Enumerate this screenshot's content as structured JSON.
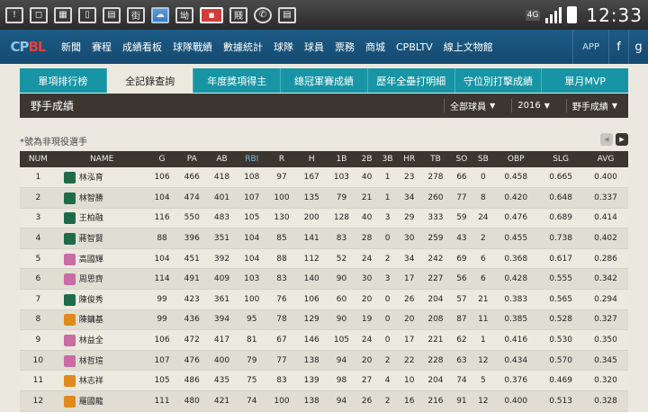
{
  "statusbar": {
    "network": "4G",
    "time": "12:33",
    "icons": [
      "m-icon",
      "phone-app-icon",
      "store-icon",
      "mobile-icon",
      "chat-icon",
      "street-icon",
      "weather-icon",
      "pos-icon",
      "costco-icon",
      "line-icon",
      "call-icon",
      "message-icon"
    ],
    "glyphs": [
      "!",
      "◻",
      "▦",
      "▯",
      "▤",
      "街",
      "☁",
      "坳",
      "■",
      "賤",
      "✆",
      "▤"
    ]
  },
  "logo": {
    "part1": "CP",
    "part2": "BL"
  },
  "nav": {
    "items": [
      "新聞",
      "賽程",
      "成績看板",
      "球隊戰績",
      "數據統計",
      "球隊",
      "球員",
      "票務",
      "商城",
      "CPBLTV",
      "線上文物館"
    ],
    "app": "APP",
    "facebook": "f",
    "google": "g"
  },
  "tabs": [
    "單項排行榜",
    "全記錄查詢",
    "年度獎項得主",
    "總冠軍賽成績",
    "歷年全壘打明細",
    "守位別打擊成績",
    "單月MVP"
  ],
  "active_tab": 1,
  "titlebar": {
    "title": "野手成績",
    "filters": [
      "全部球員",
      "2016",
      "野手成績"
    ]
  },
  "note": "*號為非現役選手",
  "pager": {
    "prev": "◀",
    "next": "▶"
  },
  "table": {
    "headers": [
      "NUM",
      "NAME",
      "G",
      "PA",
      "AB",
      "RBI",
      "R",
      "H",
      "1B",
      "2B",
      "3B",
      "HR",
      "TB",
      "SO",
      "SB",
      "OBP",
      "SLG",
      "AVG"
    ],
    "rows": [
      {
        "team": "green",
        "cells": [
          "1",
          "林泓育",
          "106",
          "466",
          "418",
          "108",
          "97",
          "167",
          "103",
          "40",
          "1",
          "23",
          "278",
          "66",
          "0",
          "0.458",
          "0.665",
          "0.400"
        ]
      },
      {
        "team": "green",
        "cells": [
          "2",
          "林智勝",
          "104",
          "474",
          "401",
          "107",
          "100",
          "135",
          "79",
          "21",
          "1",
          "34",
          "260",
          "77",
          "8",
          "0.420",
          "0.648",
          "0.337"
        ]
      },
      {
        "team": "green",
        "cells": [
          "3",
          "王柏融",
          "116",
          "550",
          "483",
          "105",
          "130",
          "200",
          "128",
          "40",
          "3",
          "29",
          "333",
          "59",
          "24",
          "0.476",
          "0.689",
          "0.414"
        ]
      },
      {
        "team": "green",
        "cells": [
          "4",
          "蔣智賢",
          "88",
          "396",
          "351",
          "104",
          "85",
          "141",
          "83",
          "28",
          "0",
          "30",
          "259",
          "43",
          "2",
          "0.455",
          "0.738",
          "0.402"
        ]
      },
      {
        "team": "pink",
        "cells": [
          "5",
          "高國輝",
          "104",
          "451",
          "392",
          "104",
          "88",
          "112",
          "52",
          "24",
          "2",
          "34",
          "242",
          "69",
          "6",
          "0.368",
          "0.617",
          "0.286"
        ]
      },
      {
        "team": "pink",
        "cells": [
          "6",
          "周思齊",
          "114",
          "491",
          "409",
          "103",
          "83",
          "140",
          "90",
          "30",
          "3",
          "17",
          "227",
          "56",
          "6",
          "0.428",
          "0.555",
          "0.342"
        ]
      },
      {
        "team": "green",
        "cells": [
          "7",
          "陳俊秀",
          "99",
          "423",
          "361",
          "100",
          "76",
          "106",
          "60",
          "20",
          "0",
          "26",
          "204",
          "57",
          "21",
          "0.383",
          "0.565",
          "0.294"
        ]
      },
      {
        "team": "orange",
        "cells": [
          "8",
          "陳鏞基",
          "99",
          "436",
          "394",
          "95",
          "78",
          "129",
          "90",
          "19",
          "0",
          "20",
          "208",
          "87",
          "11",
          "0.385",
          "0.528",
          "0.327"
        ]
      },
      {
        "team": "pink",
        "cells": [
          "9",
          "林益全",
          "106",
          "472",
          "417",
          "81",
          "67",
          "146",
          "105",
          "24",
          "0",
          "17",
          "221",
          "62",
          "1",
          "0.416",
          "0.530",
          "0.350"
        ]
      },
      {
        "team": "pink",
        "cells": [
          "10",
          "林哲瑄",
          "107",
          "476",
          "400",
          "79",
          "77",
          "138",
          "94",
          "20",
          "2",
          "22",
          "228",
          "63",
          "12",
          "0.434",
          "0.570",
          "0.345"
        ]
      },
      {
        "team": "orange",
        "cells": [
          "11",
          "林志祥",
          "105",
          "486",
          "435",
          "75",
          "83",
          "139",
          "98",
          "27",
          "4",
          "10",
          "204",
          "74",
          "5",
          "0.376",
          "0.469",
          "0.320"
        ]
      },
      {
        "team": "orange",
        "cells": [
          "12",
          "羅國龍",
          "111",
          "480",
          "421",
          "74",
          "100",
          "138",
          "94",
          "26",
          "2",
          "16",
          "216",
          "91",
          "12",
          "0.400",
          "0.513",
          "0.328"
        ]
      }
    ]
  }
}
